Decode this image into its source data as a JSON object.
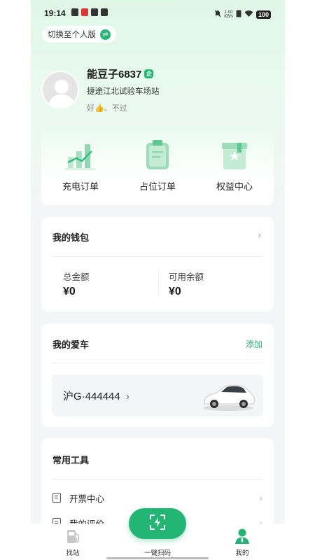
{
  "status_bar": {
    "time": "19:14",
    "speed_value": "1.00",
    "speed_unit": "KB/s",
    "battery": "100"
  },
  "switch_pill": {
    "label": "切换至个人版"
  },
  "profile": {
    "name": "能豆子6837",
    "badge": "企",
    "station": "捷途江北试验车场站",
    "tagline": "好👍、不过"
  },
  "orders": [
    {
      "label": "充电订单",
      "icon": "chart-icon"
    },
    {
      "label": "占位订单",
      "icon": "clipboard-icon"
    },
    {
      "label": "权益中心",
      "icon": "gift-box-icon"
    }
  ],
  "wallet": {
    "title": "我的钱包",
    "total_label": "总金额",
    "total_value": "¥0",
    "available_label": "可用余额",
    "available_value": "¥0"
  },
  "mycar": {
    "title": "我的爱车",
    "add_label": "添加",
    "plate": "沪G·444444"
  },
  "tools": {
    "title": "常用工具",
    "items": [
      {
        "label": "开票中心"
      },
      {
        "label": "我的评价"
      }
    ]
  },
  "bottom_nav": {
    "station": "找站",
    "scan": "一键扫码",
    "mine": "我的"
  },
  "colors": {
    "accent": "#22b573"
  }
}
